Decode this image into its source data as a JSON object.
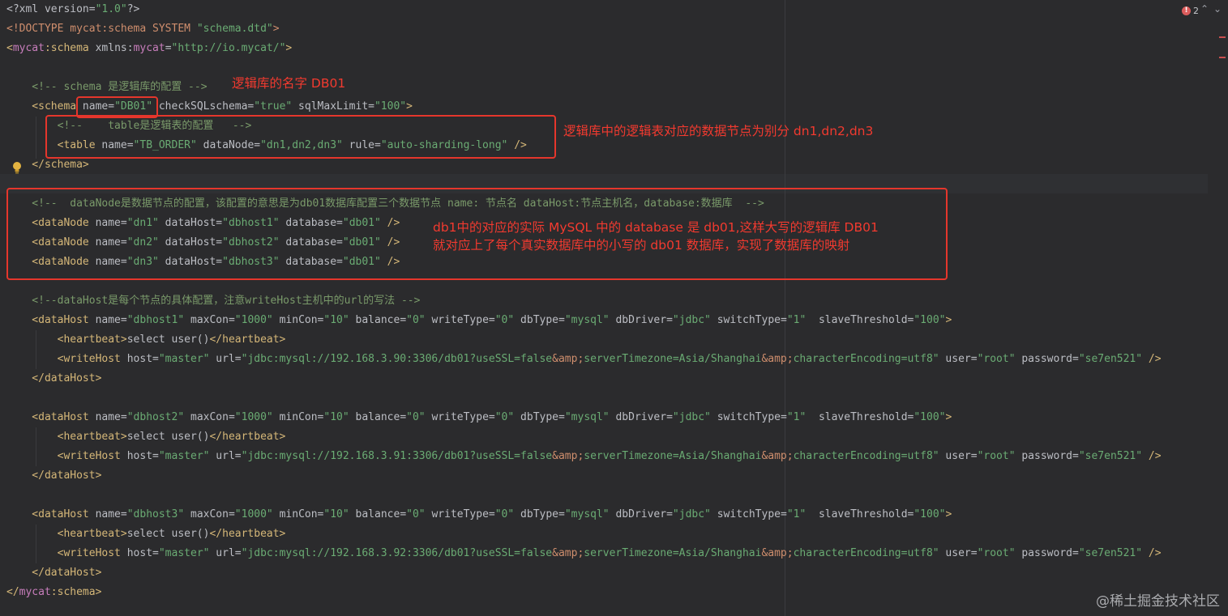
{
  "status": {
    "error_count": "2",
    "up_icon": "chevron-up-icon",
    "down_icon": "chevron-down-icon"
  },
  "code_lines": [
    [
      {
        "t": "decl",
        "v": "<?xml version="
      },
      {
        "t": "str",
        "v": "\"1.0\""
      },
      {
        "t": "decl",
        "v": "?>"
      }
    ],
    [
      {
        "t": "kw",
        "v": "<!DOCTYPE mycat:schema SYSTEM "
      },
      {
        "t": "str",
        "v": "\"schema.dtd\""
      },
      {
        "t": "kw",
        "v": ">"
      }
    ],
    [
      {
        "t": "tag",
        "v": "<"
      },
      {
        "t": "ns",
        "v": "mycat"
      },
      {
        "t": "tag",
        "v": ":schema "
      },
      {
        "t": "attr",
        "v": "xmlns:"
      },
      {
        "t": "ns",
        "v": "mycat"
      },
      {
        "t": "attr",
        "v": "="
      },
      {
        "t": "str",
        "v": "\"http://io.mycat/\""
      },
      {
        "t": "tag",
        "v": ">"
      }
    ],
    [],
    [
      {
        "t": "comment",
        "v": "    <!-- schema 是逻辑库的配置 -->"
      }
    ],
    [
      {
        "t": "tag",
        "v": "    <schema "
      },
      {
        "t": "attr",
        "v": "name="
      },
      {
        "t": "str",
        "v": "\"DB01\""
      },
      {
        "t": "attr",
        "v": " checkSQLschema="
      },
      {
        "t": "str",
        "v": "\"true\""
      },
      {
        "t": "attr",
        "v": " sqlMaxLimit="
      },
      {
        "t": "str",
        "v": "\"100\""
      },
      {
        "t": "tag",
        "v": ">"
      }
    ],
    [
      {
        "t": "comment",
        "v": "        <!--    table是逻辑表的配置   -->"
      }
    ],
    [
      {
        "t": "tag",
        "v": "        <table "
      },
      {
        "t": "attr",
        "v": "name="
      },
      {
        "t": "str",
        "v": "\"TB_ORDER\""
      },
      {
        "t": "attr",
        "v": " dataNode="
      },
      {
        "t": "str",
        "v": "\"dn1,dn2,dn3\""
      },
      {
        "t": "attr",
        "v": " rule="
      },
      {
        "t": "str",
        "v": "\"auto-sharding-long\""
      },
      {
        "t": "tag",
        "v": " />"
      }
    ],
    [
      {
        "t": "tag",
        "v": "    </schema>"
      }
    ],
    [],
    [
      {
        "t": "comment",
        "v": "    <!--  dataNode是数据节点的配置，该配置的意思是为db01数据库配置三个数据节点 name: 节点名 dataHost:节点主机名，database:数据库  -->"
      }
    ],
    [
      {
        "t": "tag",
        "v": "    <dataNode "
      },
      {
        "t": "attr",
        "v": "name="
      },
      {
        "t": "str",
        "v": "\"dn1\""
      },
      {
        "t": "attr",
        "v": " dataHost="
      },
      {
        "t": "str",
        "v": "\"dbhost1\""
      },
      {
        "t": "attr",
        "v": " database="
      },
      {
        "t": "str",
        "v": "\"db01\""
      },
      {
        "t": "tag",
        "v": " />"
      }
    ],
    [
      {
        "t": "tag",
        "v": "    <dataNode "
      },
      {
        "t": "attr",
        "v": "name="
      },
      {
        "t": "str",
        "v": "\"dn2\""
      },
      {
        "t": "attr",
        "v": " dataHost="
      },
      {
        "t": "str",
        "v": "\"dbhost2\""
      },
      {
        "t": "attr",
        "v": " database="
      },
      {
        "t": "str",
        "v": "\"db01\""
      },
      {
        "t": "tag",
        "v": " />"
      }
    ],
    [
      {
        "t": "tag",
        "v": "    <dataNode "
      },
      {
        "t": "attr",
        "v": "name="
      },
      {
        "t": "str",
        "v": "\"dn3\""
      },
      {
        "t": "attr",
        "v": " dataHost="
      },
      {
        "t": "str",
        "v": "\"dbhost3\""
      },
      {
        "t": "attr",
        "v": " database="
      },
      {
        "t": "str",
        "v": "\"db01\""
      },
      {
        "t": "tag",
        "v": " />"
      }
    ],
    [],
    [
      {
        "t": "comment",
        "v": "    <!--dataHost是每个节点的具体配置，注意writeHost主机中的url的写法 -->"
      }
    ],
    [
      {
        "t": "tag",
        "v": "    <dataHost "
      },
      {
        "t": "attr",
        "v": "name="
      },
      {
        "t": "str",
        "v": "\"dbhost1\""
      },
      {
        "t": "attr",
        "v": " maxCon="
      },
      {
        "t": "str",
        "v": "\"1000\""
      },
      {
        "t": "attr",
        "v": " minCon="
      },
      {
        "t": "str",
        "v": "\"10\""
      },
      {
        "t": "attr",
        "v": " balance="
      },
      {
        "t": "str",
        "v": "\"0\""
      },
      {
        "t": "attr",
        "v": " writeType="
      },
      {
        "t": "str",
        "v": "\"0\""
      },
      {
        "t": "attr",
        "v": " dbType="
      },
      {
        "t": "str",
        "v": "\"mysql\""
      },
      {
        "t": "attr",
        "v": " dbDriver="
      },
      {
        "t": "str",
        "v": "\"jdbc\""
      },
      {
        "t": "attr",
        "v": " switchType="
      },
      {
        "t": "str",
        "v": "\"1\""
      },
      {
        "t": "attr",
        "v": "  slaveThreshold="
      },
      {
        "t": "str",
        "v": "\"100\""
      },
      {
        "t": "tag",
        "v": ">"
      }
    ],
    [
      {
        "t": "tag",
        "v": "        <heartbeat>"
      },
      {
        "t": "text",
        "v": "select user()"
      },
      {
        "t": "tag",
        "v": "</heartbeat>"
      }
    ],
    [
      {
        "t": "tag",
        "v": "        <writeHost "
      },
      {
        "t": "attr",
        "v": "host="
      },
      {
        "t": "str",
        "v": "\"master\""
      },
      {
        "t": "attr",
        "v": " url="
      },
      {
        "t": "str",
        "v": "\"jdbc:mysql://192.168.3.90:3306/db01?useSSL=false"
      },
      {
        "t": "ent",
        "v": "&amp;"
      },
      {
        "t": "str",
        "v": "serverTimezone=Asia/Shanghai"
      },
      {
        "t": "ent",
        "v": "&amp;"
      },
      {
        "t": "str",
        "v": "characterEncoding=utf8\""
      },
      {
        "t": "attr",
        "v": " user="
      },
      {
        "t": "str",
        "v": "\"root\""
      },
      {
        "t": "attr",
        "v": " password="
      },
      {
        "t": "str",
        "v": "\"se7en521\""
      },
      {
        "t": "tag",
        "v": " />"
      }
    ],
    [
      {
        "t": "tag",
        "v": "    </dataHost>"
      }
    ],
    [],
    [
      {
        "t": "tag",
        "v": "    <dataHost "
      },
      {
        "t": "attr",
        "v": "name="
      },
      {
        "t": "str",
        "v": "\"dbhost2\""
      },
      {
        "t": "attr",
        "v": " maxCon="
      },
      {
        "t": "str",
        "v": "\"1000\""
      },
      {
        "t": "attr",
        "v": " minCon="
      },
      {
        "t": "str",
        "v": "\"10\""
      },
      {
        "t": "attr",
        "v": " balance="
      },
      {
        "t": "str",
        "v": "\"0\""
      },
      {
        "t": "attr",
        "v": " writeType="
      },
      {
        "t": "str",
        "v": "\"0\""
      },
      {
        "t": "attr",
        "v": " dbType="
      },
      {
        "t": "str",
        "v": "\"mysql\""
      },
      {
        "t": "attr",
        "v": " dbDriver="
      },
      {
        "t": "str",
        "v": "\"jdbc\""
      },
      {
        "t": "attr",
        "v": " switchType="
      },
      {
        "t": "str",
        "v": "\"1\""
      },
      {
        "t": "attr",
        "v": "  slaveThreshold="
      },
      {
        "t": "str",
        "v": "\"100\""
      },
      {
        "t": "tag",
        "v": ">"
      }
    ],
    [
      {
        "t": "tag",
        "v": "        <heartbeat>"
      },
      {
        "t": "text",
        "v": "select user()"
      },
      {
        "t": "tag",
        "v": "</heartbeat>"
      }
    ],
    [
      {
        "t": "tag",
        "v": "        <writeHost "
      },
      {
        "t": "attr",
        "v": "host="
      },
      {
        "t": "str",
        "v": "\"master\""
      },
      {
        "t": "attr",
        "v": " url="
      },
      {
        "t": "str",
        "v": "\"jdbc:mysql://192.168.3.91:3306/db01?useSSL=false"
      },
      {
        "t": "ent",
        "v": "&amp;"
      },
      {
        "t": "str",
        "v": "serverTimezone=Asia/Shanghai"
      },
      {
        "t": "ent",
        "v": "&amp;"
      },
      {
        "t": "str",
        "v": "characterEncoding=utf8\""
      },
      {
        "t": "attr",
        "v": " user="
      },
      {
        "t": "str",
        "v": "\"root\""
      },
      {
        "t": "attr",
        "v": " password="
      },
      {
        "t": "str",
        "v": "\"se7en521\""
      },
      {
        "t": "tag",
        "v": " />"
      }
    ],
    [
      {
        "t": "tag",
        "v": "    </dataHost>"
      }
    ],
    [],
    [
      {
        "t": "tag",
        "v": "    <dataHost "
      },
      {
        "t": "attr",
        "v": "name="
      },
      {
        "t": "str",
        "v": "\"dbhost3\""
      },
      {
        "t": "attr",
        "v": " maxCon="
      },
      {
        "t": "str",
        "v": "\"1000\""
      },
      {
        "t": "attr",
        "v": " minCon="
      },
      {
        "t": "str",
        "v": "\"10\""
      },
      {
        "t": "attr",
        "v": " balance="
      },
      {
        "t": "str",
        "v": "\"0\""
      },
      {
        "t": "attr",
        "v": " writeType="
      },
      {
        "t": "str",
        "v": "\"0\""
      },
      {
        "t": "attr",
        "v": " dbType="
      },
      {
        "t": "str",
        "v": "\"mysql\""
      },
      {
        "t": "attr",
        "v": " dbDriver="
      },
      {
        "t": "str",
        "v": "\"jdbc\""
      },
      {
        "t": "attr",
        "v": " switchType="
      },
      {
        "t": "str",
        "v": "\"1\""
      },
      {
        "t": "attr",
        "v": "  slaveThreshold="
      },
      {
        "t": "str",
        "v": "\"100\""
      },
      {
        "t": "tag",
        "v": ">"
      }
    ],
    [
      {
        "t": "tag",
        "v": "        <heartbeat>"
      },
      {
        "t": "text",
        "v": "select user()"
      },
      {
        "t": "tag",
        "v": "</heartbeat>"
      }
    ],
    [
      {
        "t": "tag",
        "v": "        <writeHost "
      },
      {
        "t": "attr",
        "v": "host="
      },
      {
        "t": "str",
        "v": "\"master\""
      },
      {
        "t": "attr",
        "v": " url="
      },
      {
        "t": "str",
        "v": "\"jdbc:mysql://192.168.3.92:3306/db01?useSSL=false"
      },
      {
        "t": "ent",
        "v": "&amp;"
      },
      {
        "t": "str",
        "v": "serverTimezone=Asia/Shanghai"
      },
      {
        "t": "ent",
        "v": "&amp;"
      },
      {
        "t": "str",
        "v": "characterEncoding=utf8\""
      },
      {
        "t": "attr",
        "v": " user="
      },
      {
        "t": "str",
        "v": "\"root\""
      },
      {
        "t": "attr",
        "v": " password="
      },
      {
        "t": "str",
        "v": "\"se7en521\""
      },
      {
        "t": "tag",
        "v": " />"
      }
    ],
    [
      {
        "t": "tag",
        "v": "    </dataHost>"
      }
    ],
    [
      {
        "t": "tag",
        "v": "</"
      },
      {
        "t": "ns",
        "v": "mycat"
      },
      {
        "t": "tag",
        "v": ":schema>"
      }
    ]
  ],
  "annotations": {
    "db_name_note": "逻辑库的名字 DB01",
    "table_note": "逻辑库中的逻辑表对应的数据节点为别分 dn1,dn2,dn3",
    "datanode_note": "db1中的对应的实际 MySQL 中的 database 是 db01,这样大写的逻辑库 DB01\n就对应上了每个真实数据库中的小写的 db01 数据库，实现了数据库的映射",
    "color": "#e5362c"
  },
  "watermark": "@稀土掘金技术社区"
}
